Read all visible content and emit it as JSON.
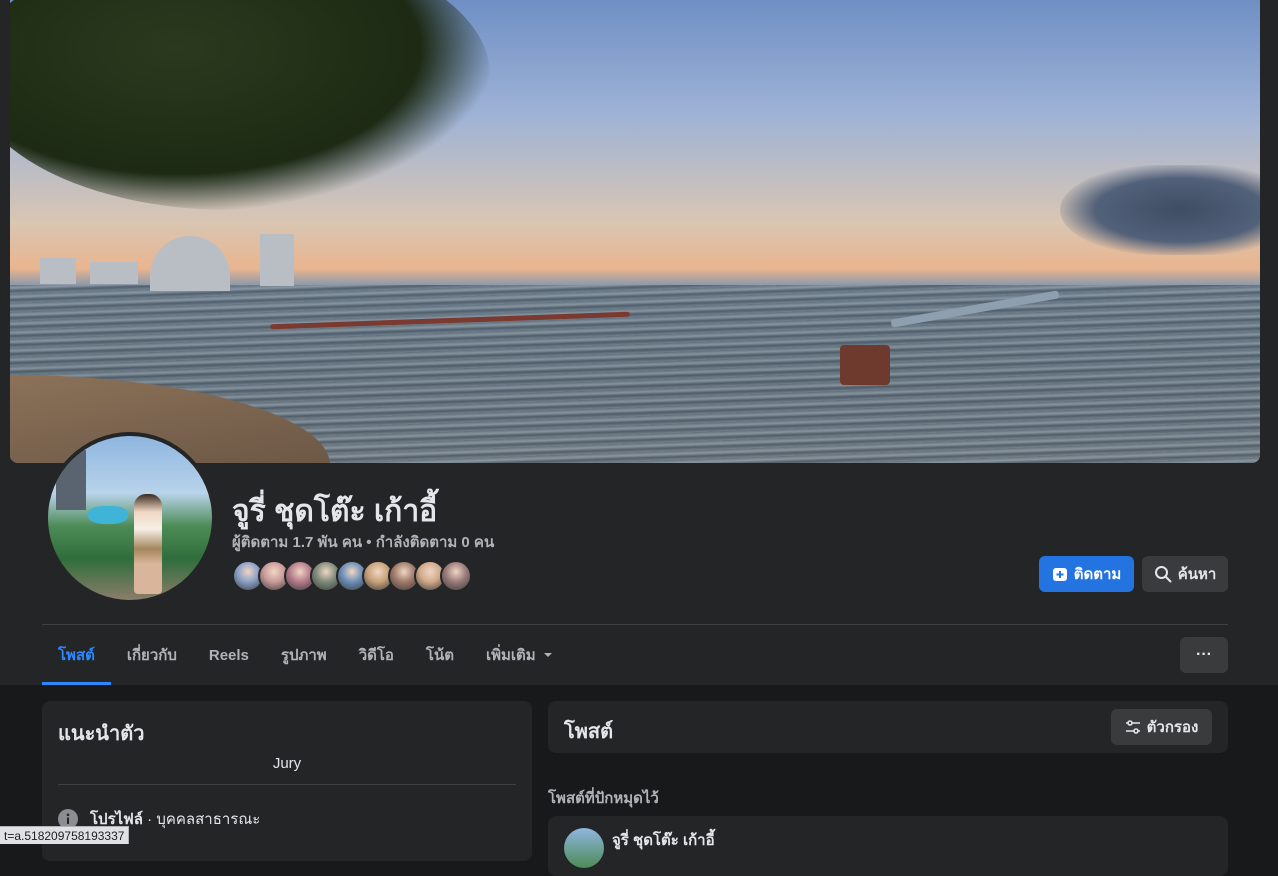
{
  "profile": {
    "name": "จูรี่ ชุดโต๊ะ เก้าอี้",
    "stats": "ผู้ติดตาม 1.7 พัน คน • กำลังติดตาม 0 คน",
    "follower_avatars": [
      "#8aa0c8",
      "#c99a9a",
      "#b47a8a",
      "#7e8a7a",
      "#6b8fb8",
      "#c7a27a",
      "#a07a6a",
      "#d1a98a",
      "#9a7a7a"
    ]
  },
  "actions": {
    "follow_label": "ติดตาม",
    "search_label": "ค้นหา"
  },
  "tabs": [
    {
      "label": "โพสต์",
      "active": true
    },
    {
      "label": "เกี่ยวกับ",
      "active": false
    },
    {
      "label": "Reels",
      "active": false
    },
    {
      "label": "รูปภาพ",
      "active": false
    },
    {
      "label": "วิดีโอ",
      "active": false
    },
    {
      "label": "โน้ต",
      "active": false
    },
    {
      "label": "เพิ่มเติม",
      "active": false
    }
  ],
  "more_menu": "···",
  "intro": {
    "title": "แนะนำตัว",
    "bio": "Jury",
    "info_bold": "โปรไฟล์",
    "info_rest": " · บุคคลสาธารณะ"
  },
  "posts": {
    "title": "โพสต์",
    "filter_label": "ตัวกรอง",
    "pinned_label": "โพสต์ที่ปักหมุดไว้",
    "pinned_author": "จูรี่ ชุดโต๊ะ เก้าอี้"
  },
  "status_url": "t=a.518209758193337",
  "colors": {
    "accent": "#2374e1",
    "active_tab": "#2d88ff",
    "background": "#18191a",
    "surface": "#242526"
  }
}
